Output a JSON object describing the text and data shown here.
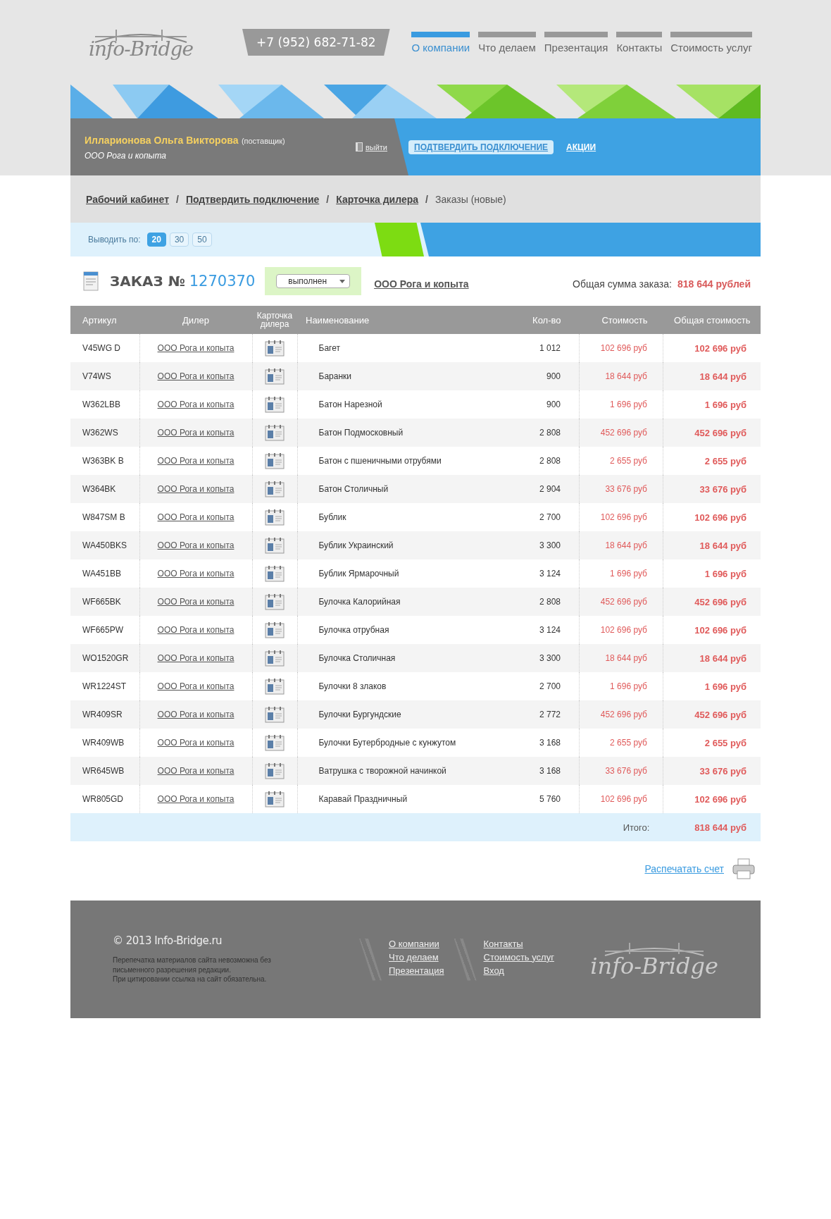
{
  "logo": {
    "text": "info-Bridge"
  },
  "phone": "+7 (952) 682-71-82",
  "nav": [
    {
      "label": "О компании",
      "selected": true
    },
    {
      "label": "Что делаем",
      "selected": false
    },
    {
      "label": "Презентация",
      "selected": false
    },
    {
      "label": "Контакты",
      "selected": false
    },
    {
      "label": "Стоимость услуг",
      "selected": false
    }
  ],
  "user": {
    "name": "Илларионова Ольга Викторова",
    "role": "(поставщик)",
    "company": "ООО Рога и копыта",
    "logout": "выйти"
  },
  "actions": [
    {
      "label": "ПОДТВЕРДИТЬ ПОДКЛЮЧЕНИЕ",
      "selected": true
    },
    {
      "label": "АКЦИИ",
      "selected": false
    }
  ],
  "breadcrumbs": [
    {
      "label": "Рабочий кабинет",
      "kind": "link"
    },
    {
      "separator": "/",
      "label": "Подтвердить подключение",
      "kind": "link"
    },
    {
      "separator": "/",
      "label": "Карточка дилера",
      "kind": "link"
    },
    {
      "separator": "/",
      "label": "Заказы (новые)",
      "kind": "current"
    }
  ],
  "per_page": {
    "label": "Выводить по:",
    "options": [
      {
        "label": "20",
        "selected": true
      },
      {
        "label": "30",
        "selected": false
      },
      {
        "label": "50",
        "selected": false
      }
    ]
  },
  "order": {
    "title": "ЗАКАЗ №",
    "number": "1270370",
    "status": "выполнен",
    "company": "ООО Рога и копыта",
    "total_label": "Общая сумма заказа:",
    "total": "818 644 рублей"
  },
  "table": {
    "columns": [
      "Артикул",
      "Дилер",
      "Карточка дилера",
      "Наименование",
      "Кол-во",
      "Стоимость",
      "Общая стоимость"
    ],
    "rows": [
      {
        "sku": "V45WG D",
        "dealer": "ООО Рога и копыта",
        "name": "Багет",
        "qty": "1 012",
        "price": "102 696 руб",
        "total": "102 696 руб"
      },
      {
        "sku": "V74WS",
        "dealer": "ООО Рога и копыта",
        "name": "Баранки",
        "qty": "900",
        "price": "18 644 руб",
        "total": "18 644 руб"
      },
      {
        "sku": "W362LBB",
        "dealer": "ООО Рога и копыта",
        "name": "Батон Нарезной",
        "qty": "900",
        "price": "1 696 руб",
        "total": "1 696 руб"
      },
      {
        "sku": "W362WS",
        "dealer": "ООО Рога и копыта",
        "name": "Батон Подмосковный",
        "qty": "2 808",
        "price": "452 696 руб",
        "total": "452 696 руб"
      },
      {
        "sku": "W363BK B",
        "dealer": "ООО Рога и копыта",
        "name": "Батон с пшеничными отрубями",
        "qty": "2 808",
        "price": "2 655 руб",
        "total": "2 655 руб"
      },
      {
        "sku": "W364BK",
        "dealer": "ООО Рога и копыта",
        "name": "Батон Столичный",
        "qty": "2 904",
        "price": "33 676 руб",
        "total": "33 676 руб"
      },
      {
        "sku": "W847SM B",
        "dealer": "ООО Рога и копыта",
        "name": "Бублик",
        "qty": "2 700",
        "price": "102 696 руб",
        "total": "102 696 руб"
      },
      {
        "sku": "WA450BKS",
        "dealer": "ООО Рога и копыта",
        "name": "Бублик Украинский",
        "qty": "3 300",
        "price": "18 644 руб",
        "total": "18 644 руб"
      },
      {
        "sku": "WA451BB",
        "dealer": "ООО Рога и копыта",
        "name": "Бублик Ярмарочный",
        "qty": "3 124",
        "price": "1 696 руб",
        "total": "1 696 руб"
      },
      {
        "sku": "WF665BK",
        "dealer": "ООО Рога и копыта",
        "name": "Булочка Калорийная",
        "qty": "2 808",
        "price": "452 696 руб",
        "total": "452 696 руб"
      },
      {
        "sku": "WF665PW",
        "dealer": "ООО Рога и копыта",
        "name": "Булочка отрубная",
        "qty": "3 124",
        "price": "102 696 руб",
        "total": "102 696 руб"
      },
      {
        "sku": "WO1520GR",
        "dealer": "ООО Рога и копыта",
        "name": "Булочка Столичная",
        "qty": "3 300",
        "price": "18 644 руб",
        "total": "18 644 руб"
      },
      {
        "sku": "WR1224ST",
        "dealer": "ООО Рога и копыта",
        "name": "Булочки 8 злаков",
        "qty": "2 700",
        "price": "1 696 руб",
        "total": "1 696 руб"
      },
      {
        "sku": "WR409SR",
        "dealer": "ООО Рога и копыта",
        "name": "Булочки Бургундские",
        "qty": "2 772",
        "price": "452 696 руб",
        "total": "452 696 руб"
      },
      {
        "sku": "WR409WB",
        "dealer": "ООО Рога и копыта",
        "name": "Булочки Бутербродные с кунжутом",
        "qty": "3 168",
        "price": "2 655 руб",
        "total": "2 655 руб"
      },
      {
        "sku": "WR645WB",
        "dealer": "ООО Рога и копыта",
        "name": "Ватрушка с творожной начинкой",
        "qty": "3 168",
        "price": "33 676 руб",
        "total": "33 676 руб"
      },
      {
        "sku": "WR805GD",
        "dealer": "ООО Рога и копыта",
        "name": "Каравай Праздничный",
        "qty": "5 760",
        "price": "102 696 руб",
        "total": "102 696 руб"
      }
    ],
    "total_label": "Итого:",
    "total": "818 644 руб"
  },
  "print": "Распечатать счет",
  "footer": {
    "copyright": "© 2013 Info-Bridge.ru",
    "notice": [
      "Перепечатка материалов сайта невозможна без",
      "письменного разрешения редакции.",
      "При цитировании ссылка на сайт обязательна."
    ],
    "links": [
      [
        "О компании",
        "Что делаем",
        "Презентация"
      ],
      [
        "Контакты",
        "Стоимость услуг",
        "Вход"
      ]
    ],
    "logo": "info-Bridge"
  }
}
